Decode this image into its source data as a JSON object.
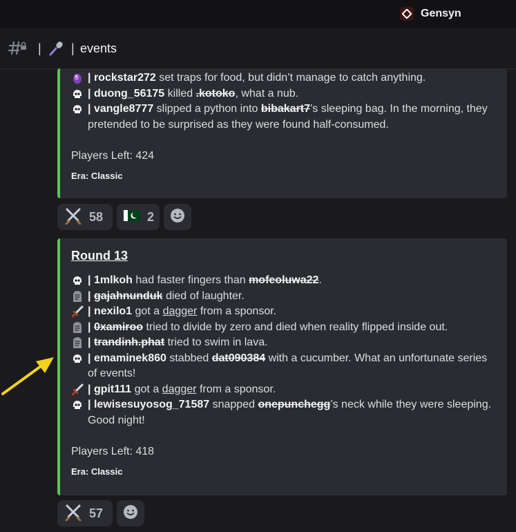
{
  "server": {
    "name": "Gensyn"
  },
  "channel": {
    "sep1": "|",
    "sep2": "|",
    "name": "events"
  },
  "embed1": {
    "lines": [
      {
        "icon": "purple-orb-icon",
        "sep": "|",
        "user": "rockstar272",
        "text": " set traps for food, but didn’t manage to catch anything."
      },
      {
        "icon": "skull-icon",
        "sep": "|",
        "user": "duong_56175",
        "text1": " killed ",
        "victim": ".kotoko",
        "text2": ", what a nub."
      },
      {
        "icon": "skull-icon",
        "sep": "|",
        "user": "vangle8777",
        "text1": " slipped a python into ",
        "victim": "bibakart7",
        "text2": "’s sleeping bag. In the morning, they pretended to be surprised as they were found half-consumed."
      }
    ],
    "players_left": "Players Left: 424",
    "era": "Era: Classic"
  },
  "reactions1": [
    {
      "icon": "crossed-swords-icon",
      "count": "58"
    },
    {
      "icon": "pakistan-flag-icon",
      "count": "2"
    }
  ],
  "embed2": {
    "title": "Round 13",
    "lines": [
      {
        "icon": "skull-icon",
        "sep": "|",
        "user": "1mlkoh",
        "text1": " had faster fingers than ",
        "victim": "mofeoluwa22",
        "text2": "."
      },
      {
        "icon": "tombstone-icon",
        "sep": "|",
        "victim": "gajahnunduk",
        "text2": " died of laughter."
      },
      {
        "icon": "dagger-icon",
        "sep": "|",
        "user": "nexilo1",
        "text1": " got a ",
        "item": "dagger",
        "text2": " from a sponsor."
      },
      {
        "icon": "tombstone-icon",
        "sep": "|",
        "victim": "0xamiroo",
        "text2": " tried to divide by zero and died when reality flipped inside out."
      },
      {
        "icon": "tombstone-icon",
        "sep": "|",
        "victim": "trandinh.phat",
        "text2": " tried to swim in lava."
      },
      {
        "icon": "skull-icon",
        "sep": "|",
        "user": "emaminek860",
        "text1": " stabbed ",
        "victim": "dat090384",
        "text2": " with a cucumber. What an unfortunate series of events!"
      },
      {
        "icon": "dagger-icon",
        "sep": "|",
        "user": "gpit111",
        "text1": " got a ",
        "item": "dagger",
        "text2": " from a sponsor."
      },
      {
        "icon": "skull-icon",
        "sep": "|",
        "user": "lewisesuyosog_71587",
        "text1": " snapped ",
        "victim": "onepunchegg",
        "text2": "’s neck while they were sleeping. Good night!"
      }
    ],
    "players_left": "Players Left: 418",
    "era": "Era: Classic"
  },
  "reactions2": [
    {
      "icon": "crossed-swords-icon",
      "count": "57"
    }
  ],
  "colors": {
    "embed_border": "#57c655",
    "arrow": "#f2d21b",
    "background": "#1a1a1e",
    "embed_bg": "#2b2c31"
  }
}
